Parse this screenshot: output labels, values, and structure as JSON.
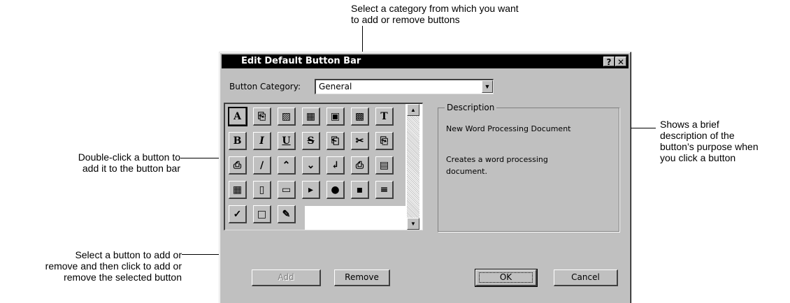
{
  "callouts": {
    "top": [
      "Select a category from which you want",
      "to add or remove buttons"
    ],
    "right": [
      "Shows a brief",
      "description of the",
      "button’s purpose when",
      "you click a button"
    ],
    "left_mid": [
      "Double-click a button to",
      "add it to the button bar"
    ],
    "left_bottom": [
      "Select a button to add or",
      "remove and then click to add or",
      "remove the selected button"
    ]
  },
  "dialog": {
    "title": "Edit Default Button Bar",
    "help_glyph": "?",
    "close_glyph": "✕",
    "category_label": "Button Category:",
    "category_value": "General",
    "description_group": "Description",
    "description_title": "New Word Processing Document",
    "description_body": "Creates a word processing document.",
    "buttons": {
      "add": "Add",
      "remove": "Remove",
      "ok": "OK",
      "cancel": "Cancel"
    },
    "icons": [
      {
        "name": "new-wp-doc-icon",
        "glyph": "A"
      },
      {
        "name": "wp-doc-icon",
        "glyph": "⎘"
      },
      {
        "name": "doc-template-icon",
        "glyph": "▨"
      },
      {
        "name": "spreadsheet-icon",
        "glyph": "▦"
      },
      {
        "name": "presentation-icon",
        "glyph": "▣"
      },
      {
        "name": "drawing-icon",
        "glyph": "▩"
      },
      {
        "name": "text-icon",
        "glyph": "T"
      },
      {
        "name": "bold-icon",
        "glyph": "B"
      },
      {
        "name": "italic-icon",
        "glyph": "I"
      },
      {
        "name": "underline-icon",
        "glyph": "U"
      },
      {
        "name": "strikeout-icon",
        "glyph": "S"
      },
      {
        "name": "copy-icon",
        "glyph": "⎗"
      },
      {
        "name": "cut-icon",
        "glyph": "✂"
      },
      {
        "name": "paste-icon",
        "glyph": "⎘"
      },
      {
        "name": "paste-special-icon",
        "glyph": "⎙"
      },
      {
        "name": "pen-icon",
        "glyph": "∕"
      },
      {
        "name": "open-folder-icon",
        "glyph": "⌃"
      },
      {
        "name": "save-folder-icon",
        "glyph": "⌄"
      },
      {
        "name": "insert-file-icon",
        "glyph": "↲"
      },
      {
        "name": "print-icon",
        "glyph": "⎙"
      },
      {
        "name": "multiple-windows-icon",
        "glyph": "▤"
      },
      {
        "name": "tile-windows-icon",
        "glyph": "▦"
      },
      {
        "name": "page-icon",
        "glyph": "▯"
      },
      {
        "name": "page-margin-icon",
        "glyph": "▭"
      },
      {
        "name": "macro-play-icon",
        "glyph": "▸"
      },
      {
        "name": "macro-record-icon",
        "glyph": "●"
      },
      {
        "name": "macro-edit-icon",
        "glyph": "▪"
      },
      {
        "name": "macro-list-icon",
        "glyph": "≡"
      },
      {
        "name": "spell-check-icon",
        "glyph": "✓"
      },
      {
        "name": "frame-icon",
        "glyph": "□"
      },
      {
        "name": "edit-icon",
        "glyph": "✎"
      }
    ]
  }
}
